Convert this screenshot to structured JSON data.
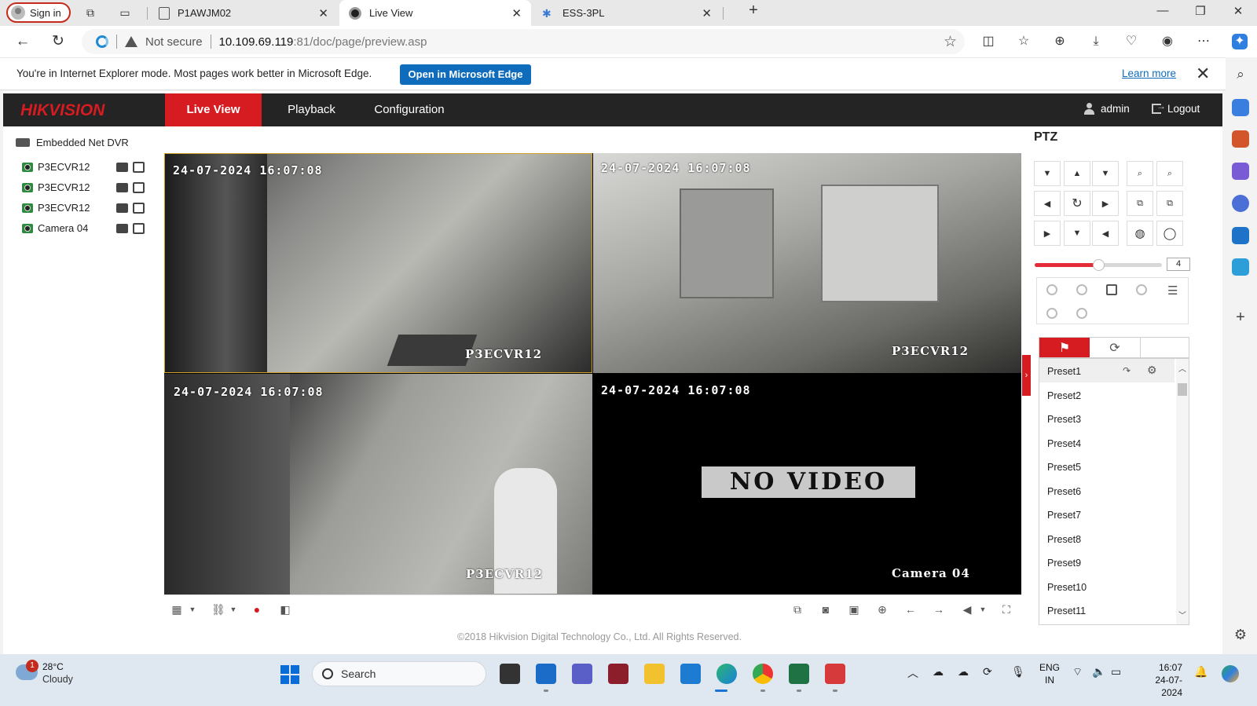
{
  "browser": {
    "signin_label": "Sign in",
    "tabs": [
      {
        "title": "P1AWJM02",
        "close": "✕"
      },
      {
        "title": "Live View",
        "close": "✕"
      },
      {
        "title": "ESS-3PL",
        "close": "✕"
      }
    ],
    "new_tab": "+",
    "window_controls": {
      "minimize": "—",
      "restore": "❐",
      "close": "✕"
    },
    "not_secure": "Not secure",
    "url_host": "10.109.69.119",
    "url_rest": ":81/doc/page/preview.asp"
  },
  "ie_bar": {
    "message": "You're in Internet Explorer mode. Most pages work better in Microsoft Edge.",
    "open_button": "Open in Microsoft Edge",
    "learn_more": "Learn more",
    "close": "✕"
  },
  "hikvision": {
    "logo": "HIKVISION",
    "nav": [
      "Live View",
      "Playback",
      "Configuration"
    ],
    "user": "admin",
    "logout": "Logout",
    "device_root": "Embedded Net DVR",
    "cameras": [
      "P3ECVR12",
      "P3ECVR12",
      "P3ECVR12",
      "Camera 04"
    ],
    "tiles": [
      {
        "timestamp": "24-07-2024 16:07:08",
        "camera": "P3ECVR12",
        "selected": true
      },
      {
        "timestamp": "24-07-2024 16:07:08",
        "camera": "P3ECVR12",
        "selected": false
      },
      {
        "timestamp": "24-07-2024 16:07:08",
        "camera": "P3ECVR12",
        "selected": false
      },
      {
        "timestamp": "24-07-2024 16:07:08",
        "camera": "Camera 04",
        "no_video": "NO VIDEO"
      }
    ],
    "copyright": "©2018 Hikvision Digital Technology Co., Ltd. All Rights Reserved.",
    "ptz": {
      "title": "PTZ",
      "speed": "4",
      "speed_fraction": 0.5,
      "presets": [
        "Preset1",
        "Preset2",
        "Preset3",
        "Preset4",
        "Preset5",
        "Preset6",
        "Preset7",
        "Preset8",
        "Preset9",
        "Preset10",
        "Preset11"
      ]
    },
    "colors": {
      "brand_red": "#d61b21",
      "header_bg": "#242424"
    }
  },
  "taskbar": {
    "temp": "28°C",
    "weather": "Cloudy",
    "weather_badge": "1",
    "search": "Search",
    "lang_top": "ENG",
    "lang_bottom": "IN",
    "time": "16:07",
    "date": "24-07-2024"
  }
}
